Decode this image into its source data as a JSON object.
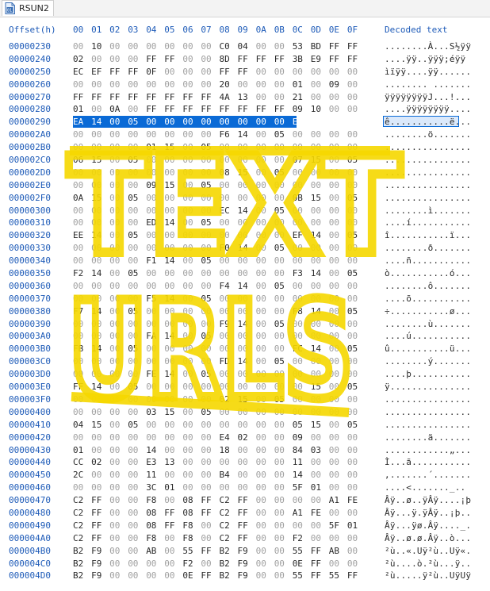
{
  "tab": {
    "label": "RSUN2",
    "icon": "binary-file-icon"
  },
  "header": {
    "offset_label": "Offset(h)",
    "columns": [
      "00",
      "01",
      "02",
      "03",
      "04",
      "05",
      "06",
      "07",
      "08",
      "09",
      "0A",
      "0B",
      "0C",
      "0D",
      "0E",
      "0F"
    ],
    "decoded_label": "Decoded text"
  },
  "overlay": {
    "line1": "TEXT",
    "line2": "URLS"
  },
  "rows": [
    {
      "addr": "00000230",
      "bytes": [
        "00",
        "10",
        "00",
        "00",
        "00",
        "00",
        "00",
        "00",
        "C0",
        "04",
        "00",
        "00",
        "53",
        "BD",
        "FF",
        "FF"
      ],
      "text": "........À...S½ÿÿ"
    },
    {
      "addr": "00000240",
      "bytes": [
        "02",
        "00",
        "00",
        "00",
        "FF",
        "FF",
        "00",
        "00",
        "8D",
        "FF",
        "FF",
        "FF",
        "3B",
        "E9",
        "FF",
        "FF"
      ],
      "text": "....ÿÿ..ÿÿÿ;éÿÿ"
    },
    {
      "addr": "00000250",
      "bytes": [
        "EC",
        "EF",
        "FF",
        "FF",
        "0F",
        "00",
        "00",
        "00",
        "FF",
        "FF",
        "00",
        "00",
        "00",
        "00",
        "00",
        "00"
      ],
      "text": "ìïÿÿ....ÿÿ......"
    },
    {
      "addr": "00000260",
      "bytes": [
        "00",
        "00",
        "00",
        "00",
        "00",
        "00",
        "00",
        "00",
        "20",
        "00",
        "00",
        "00",
        "01",
        "00",
        "09",
        "00"
      ],
      "text": "........ ......."
    },
    {
      "addr": "00000270",
      "bytes": [
        "FF",
        "FF",
        "FF",
        "FF",
        "FF",
        "FF",
        "FF",
        "FF",
        "4A",
        "13",
        "00",
        "00",
        "21",
        "00",
        "00",
        "00"
      ],
      "text": "ÿÿÿÿÿÿÿÿJ...!..."
    },
    {
      "addr": "00000280",
      "bytes": [
        "01",
        "00",
        "0A",
        "00",
        "FF",
        "FF",
        "FF",
        "FF",
        "FF",
        "FF",
        "FF",
        "FF",
        "09",
        "10",
        "00",
        "00"
      ],
      "text": "....ÿÿÿÿÿÿÿÿ...."
    },
    {
      "addr": "00000290",
      "bytes": [
        "EA",
        "14",
        "00",
        "05",
        "00",
        "00",
        "00",
        "00",
        "00",
        "00",
        "00",
        "00",
        "EB",
        "14",
        "00",
        "05"
      ],
      "text": "ê...........ë...",
      "selected": true
    },
    {
      "addr": "000002A0",
      "bytes": [
        "00",
        "00",
        "00",
        "00",
        "00",
        "00",
        "00",
        "00",
        "F6",
        "14",
        "00",
        "05",
        "00",
        "00",
        "00",
        "00"
      ],
      "text": "........ö......."
    },
    {
      "addr": "000002B0",
      "bytes": [
        "00",
        "00",
        "00",
        "00",
        "01",
        "15",
        "00",
        "05",
        "00",
        "00",
        "00",
        "00",
        "00",
        "00",
        "00",
        "00"
      ],
      "text": "................"
    },
    {
      "addr": "000002C0",
      "bytes": [
        "06",
        "15",
        "00",
        "05",
        "00",
        "00",
        "00",
        "00",
        "00",
        "00",
        "00",
        "00",
        "07",
        "15",
        "00",
        "05"
      ],
      "text": "................"
    },
    {
      "addr": "000002D0",
      "bytes": [
        "00",
        "00",
        "00",
        "00",
        "00",
        "00",
        "00",
        "00",
        "08",
        "15",
        "00",
        "05",
        "00",
        "00",
        "00",
        "00"
      ],
      "text": "................"
    },
    {
      "addr": "000002E0",
      "bytes": [
        "00",
        "00",
        "00",
        "00",
        "09",
        "15",
        "00",
        "05",
        "00",
        "00",
        "00",
        "00",
        "00",
        "00",
        "00",
        "00"
      ],
      "text": "................"
    },
    {
      "addr": "000002F0",
      "bytes": [
        "0A",
        "15",
        "00",
        "05",
        "00",
        "00",
        "00",
        "00",
        "00",
        "00",
        "00",
        "00",
        "0B",
        "15",
        "00",
        "05"
      ],
      "text": "................"
    },
    {
      "addr": "00000300",
      "bytes": [
        "00",
        "00",
        "00",
        "00",
        "00",
        "00",
        "00",
        "00",
        "EC",
        "14",
        "00",
        "05",
        "00",
        "00",
        "00",
        "00"
      ],
      "text": "........ì......."
    },
    {
      "addr": "00000310",
      "bytes": [
        "00",
        "00",
        "00",
        "00",
        "ED",
        "14",
        "00",
        "05",
        "00",
        "00",
        "00",
        "00",
        "00",
        "00",
        "00",
        "00"
      ],
      "text": "....í..........."
    },
    {
      "addr": "00000320",
      "bytes": [
        "EE",
        "14",
        "00",
        "05",
        "00",
        "00",
        "00",
        "00",
        "00",
        "00",
        "00",
        "00",
        "EF",
        "14",
        "00",
        "05"
      ],
      "text": "î...........ï..."
    },
    {
      "addr": "00000330",
      "bytes": [
        "00",
        "00",
        "00",
        "00",
        "00",
        "00",
        "00",
        "00",
        "F0",
        "14",
        "00",
        "05",
        "00",
        "00",
        "00",
        "00"
      ],
      "text": "........ð......."
    },
    {
      "addr": "00000340",
      "bytes": [
        "00",
        "00",
        "00",
        "00",
        "F1",
        "14",
        "00",
        "05",
        "00",
        "00",
        "00",
        "00",
        "00",
        "00",
        "00",
        "00"
      ],
      "text": "....ñ..........."
    },
    {
      "addr": "00000350",
      "bytes": [
        "F2",
        "14",
        "00",
        "05",
        "00",
        "00",
        "00",
        "00",
        "00",
        "00",
        "00",
        "00",
        "F3",
        "14",
        "00",
        "05"
      ],
      "text": "ò...........ó..."
    },
    {
      "addr": "00000360",
      "bytes": [
        "00",
        "00",
        "00",
        "00",
        "00",
        "00",
        "00",
        "00",
        "F4",
        "14",
        "00",
        "05",
        "00",
        "00",
        "00",
        "00"
      ],
      "text": "........ô......."
    },
    {
      "addr": "00000370",
      "bytes": [
        "00",
        "00",
        "00",
        "00",
        "F5",
        "14",
        "00",
        "05",
        "00",
        "00",
        "00",
        "00",
        "00",
        "00",
        "00",
        "00"
      ],
      "text": "....õ..........."
    },
    {
      "addr": "00000380",
      "bytes": [
        "F7",
        "14",
        "00",
        "05",
        "00",
        "00",
        "00",
        "00",
        "00",
        "00",
        "00",
        "00",
        "F8",
        "14",
        "00",
        "05"
      ],
      "text": "÷...........ø..."
    },
    {
      "addr": "00000390",
      "bytes": [
        "00",
        "00",
        "00",
        "00",
        "00",
        "00",
        "00",
        "00",
        "F9",
        "14",
        "00",
        "05",
        "00",
        "00",
        "00",
        "00"
      ],
      "text": "........ù......."
    },
    {
      "addr": "000003A0",
      "bytes": [
        "00",
        "00",
        "00",
        "00",
        "FA",
        "14",
        "00",
        "05",
        "00",
        "00",
        "00",
        "00",
        "00",
        "00",
        "00",
        "00"
      ],
      "text": "....ú..........."
    },
    {
      "addr": "000003B0",
      "bytes": [
        "FB",
        "14",
        "00",
        "05",
        "00",
        "00",
        "00",
        "00",
        "00",
        "00",
        "00",
        "00",
        "FC",
        "14",
        "00",
        "05"
      ],
      "text": "û...........ü..."
    },
    {
      "addr": "000003C0",
      "bytes": [
        "00",
        "00",
        "00",
        "00",
        "00",
        "00",
        "00",
        "00",
        "FD",
        "14",
        "00",
        "05",
        "00",
        "00",
        "00",
        "00"
      ],
      "text": "........ý......."
    },
    {
      "addr": "000003D0",
      "bytes": [
        "00",
        "00",
        "00",
        "00",
        "FE",
        "14",
        "00",
        "05",
        "00",
        "00",
        "00",
        "00",
        "00",
        "00",
        "00",
        "00"
      ],
      "text": "....þ..........."
    },
    {
      "addr": "000003E0",
      "bytes": [
        "FF",
        "14",
        "00",
        "05",
        "00",
        "00",
        "00",
        "00",
        "00",
        "00",
        "00",
        "00",
        "00",
        "15",
        "00",
        "05"
      ],
      "text": "ÿ..............."
    },
    {
      "addr": "000003F0",
      "bytes": [
        "00",
        "00",
        "00",
        "00",
        "00",
        "00",
        "00",
        "00",
        "02",
        "15",
        "00",
        "05",
        "00",
        "00",
        "00",
        "00"
      ],
      "text": "................"
    },
    {
      "addr": "00000400",
      "bytes": [
        "00",
        "00",
        "00",
        "00",
        "03",
        "15",
        "00",
        "05",
        "00",
        "00",
        "00",
        "00",
        "00",
        "00",
        "00",
        "00"
      ],
      "text": "................"
    },
    {
      "addr": "00000410",
      "bytes": [
        "04",
        "15",
        "00",
        "05",
        "00",
        "00",
        "00",
        "00",
        "00",
        "00",
        "00",
        "00",
        "05",
        "15",
        "00",
        "05"
      ],
      "text": "................"
    },
    {
      "addr": "00000420",
      "bytes": [
        "00",
        "00",
        "00",
        "00",
        "00",
        "00",
        "00",
        "00",
        "E4",
        "02",
        "00",
        "00",
        "09",
        "00",
        "00",
        "00"
      ],
      "text": "........ä......."
    },
    {
      "addr": "00000430",
      "bytes": [
        "01",
        "00",
        "00",
        "00",
        "14",
        "00",
        "00",
        "00",
        "18",
        "00",
        "00",
        "00",
        "84",
        "03",
        "00",
        "00"
      ],
      "text": "............„..."
    },
    {
      "addr": "00000440",
      "bytes": [
        "CC",
        "02",
        "00",
        "00",
        "E3",
        "13",
        "00",
        "00",
        "00",
        "00",
        "00",
        "00",
        "11",
        "00",
        "00",
        "00"
      ],
      "text": "Ì...ã..........."
    },
    {
      "addr": "00000450",
      "bytes": [
        "2C",
        "00",
        "00",
        "00",
        "11",
        "00",
        "00",
        "00",
        "B4",
        "00",
        "00",
        "00",
        "14",
        "00",
        "00",
        "00"
      ],
      "text": ",.......´......."
    },
    {
      "addr": "00000460",
      "bytes": [
        "00",
        "00",
        "00",
        "00",
        "3C",
        "01",
        "00",
        "00",
        "00",
        "00",
        "00",
        "00",
        "5F",
        "01",
        "00",
        "00"
      ],
      "text": "....<......._.."
    },
    {
      "addr": "00000470",
      "bytes": [
        "C2",
        "FF",
        "00",
        "00",
        "F8",
        "00",
        "08",
        "FF",
        "C2",
        "FF",
        "00",
        "00",
        "00",
        "00",
        "A1",
        "FE"
      ],
      "text": "Âÿ..ø..ÿÂÿ....¡þ"
    },
    {
      "addr": "00000480",
      "bytes": [
        "C2",
        "FF",
        "00",
        "00",
        "08",
        "FF",
        "08",
        "FF",
        "C2",
        "FF",
        "00",
        "00",
        "A1",
        "FE",
        "00",
        "00"
      ],
      "text": "Âÿ...ÿ.ÿÂÿ..¡þ.."
    },
    {
      "addr": "00000490",
      "bytes": [
        "C2",
        "FF",
        "00",
        "00",
        "08",
        "FF",
        "F8",
        "00",
        "C2",
        "FF",
        "00",
        "00",
        "00",
        "00",
        "5F",
        "01"
      ],
      "text": "Âÿ...ÿø.Âÿ...._."
    },
    {
      "addr": "000004A0",
      "bytes": [
        "C2",
        "FF",
        "00",
        "00",
        "F8",
        "00",
        "F8",
        "00",
        "C2",
        "FF",
        "00",
        "00",
        "F2",
        "00",
        "00",
        "00"
      ],
      "text": "Âÿ..ø.ø.Âÿ..ò..."
    },
    {
      "addr": "000004B0",
      "bytes": [
        "B2",
        "F9",
        "00",
        "00",
        "AB",
        "00",
        "55",
        "FF",
        "B2",
        "F9",
        "00",
        "00",
        "55",
        "FF",
        "AB",
        "00"
      ],
      "text": "²ù..«.Uÿ²ù..Uÿ«."
    },
    {
      "addr": "000004C0",
      "bytes": [
        "B2",
        "F9",
        "00",
        "00",
        "00",
        "00",
        "F2",
        "00",
        "B2",
        "F9",
        "00",
        "00",
        "0E",
        "FF",
        "00",
        "00"
      ],
      "text": "²ù....ò.²ù...ÿ.."
    },
    {
      "addr": "000004D0",
      "bytes": [
        "B2",
        "F9",
        "00",
        "00",
        "00",
        "00",
        "0E",
        "FF",
        "B2",
        "F9",
        "00",
        "00",
        "55",
        "FF",
        "55",
        "FF"
      ],
      "text": "²ù.....ÿ²ù..UÿUÿ"
    }
  ]
}
